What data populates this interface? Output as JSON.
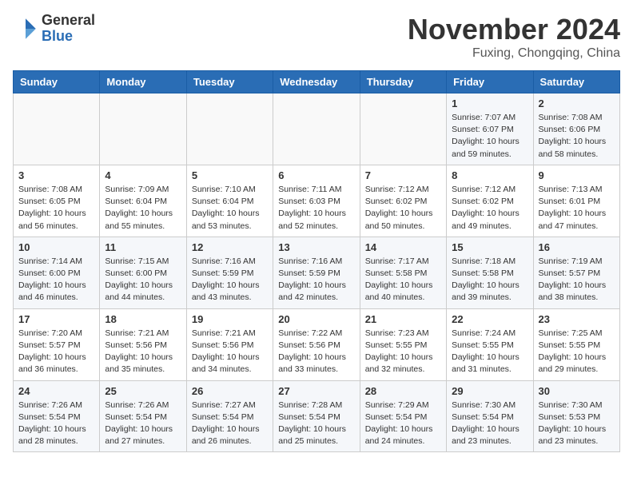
{
  "header": {
    "logo_general": "General",
    "logo_blue": "Blue",
    "title": "November 2024",
    "subtitle": "Fuxing, Chongqing, China"
  },
  "weekdays": [
    "Sunday",
    "Monday",
    "Tuesday",
    "Wednesday",
    "Thursday",
    "Friday",
    "Saturday"
  ],
  "weeks": [
    [
      {
        "day": "",
        "info": ""
      },
      {
        "day": "",
        "info": ""
      },
      {
        "day": "",
        "info": ""
      },
      {
        "day": "",
        "info": ""
      },
      {
        "day": "",
        "info": ""
      },
      {
        "day": "1",
        "info": "Sunrise: 7:07 AM\nSunset: 6:07 PM\nDaylight: 10 hours\nand 59 minutes."
      },
      {
        "day": "2",
        "info": "Sunrise: 7:08 AM\nSunset: 6:06 PM\nDaylight: 10 hours\nand 58 minutes."
      }
    ],
    [
      {
        "day": "3",
        "info": "Sunrise: 7:08 AM\nSunset: 6:05 PM\nDaylight: 10 hours\nand 56 minutes."
      },
      {
        "day": "4",
        "info": "Sunrise: 7:09 AM\nSunset: 6:04 PM\nDaylight: 10 hours\nand 55 minutes."
      },
      {
        "day": "5",
        "info": "Sunrise: 7:10 AM\nSunset: 6:04 PM\nDaylight: 10 hours\nand 53 minutes."
      },
      {
        "day": "6",
        "info": "Sunrise: 7:11 AM\nSunset: 6:03 PM\nDaylight: 10 hours\nand 52 minutes."
      },
      {
        "day": "7",
        "info": "Sunrise: 7:12 AM\nSunset: 6:02 PM\nDaylight: 10 hours\nand 50 minutes."
      },
      {
        "day": "8",
        "info": "Sunrise: 7:12 AM\nSunset: 6:02 PM\nDaylight: 10 hours\nand 49 minutes."
      },
      {
        "day": "9",
        "info": "Sunrise: 7:13 AM\nSunset: 6:01 PM\nDaylight: 10 hours\nand 47 minutes."
      }
    ],
    [
      {
        "day": "10",
        "info": "Sunrise: 7:14 AM\nSunset: 6:00 PM\nDaylight: 10 hours\nand 46 minutes."
      },
      {
        "day": "11",
        "info": "Sunrise: 7:15 AM\nSunset: 6:00 PM\nDaylight: 10 hours\nand 44 minutes."
      },
      {
        "day": "12",
        "info": "Sunrise: 7:16 AM\nSunset: 5:59 PM\nDaylight: 10 hours\nand 43 minutes."
      },
      {
        "day": "13",
        "info": "Sunrise: 7:16 AM\nSunset: 5:59 PM\nDaylight: 10 hours\nand 42 minutes."
      },
      {
        "day": "14",
        "info": "Sunrise: 7:17 AM\nSunset: 5:58 PM\nDaylight: 10 hours\nand 40 minutes."
      },
      {
        "day": "15",
        "info": "Sunrise: 7:18 AM\nSunset: 5:58 PM\nDaylight: 10 hours\nand 39 minutes."
      },
      {
        "day": "16",
        "info": "Sunrise: 7:19 AM\nSunset: 5:57 PM\nDaylight: 10 hours\nand 38 minutes."
      }
    ],
    [
      {
        "day": "17",
        "info": "Sunrise: 7:20 AM\nSunset: 5:57 PM\nDaylight: 10 hours\nand 36 minutes."
      },
      {
        "day": "18",
        "info": "Sunrise: 7:21 AM\nSunset: 5:56 PM\nDaylight: 10 hours\nand 35 minutes."
      },
      {
        "day": "19",
        "info": "Sunrise: 7:21 AM\nSunset: 5:56 PM\nDaylight: 10 hours\nand 34 minutes."
      },
      {
        "day": "20",
        "info": "Sunrise: 7:22 AM\nSunset: 5:56 PM\nDaylight: 10 hours\nand 33 minutes."
      },
      {
        "day": "21",
        "info": "Sunrise: 7:23 AM\nSunset: 5:55 PM\nDaylight: 10 hours\nand 32 minutes."
      },
      {
        "day": "22",
        "info": "Sunrise: 7:24 AM\nSunset: 5:55 PM\nDaylight: 10 hours\nand 31 minutes."
      },
      {
        "day": "23",
        "info": "Sunrise: 7:25 AM\nSunset: 5:55 PM\nDaylight: 10 hours\nand 29 minutes."
      }
    ],
    [
      {
        "day": "24",
        "info": "Sunrise: 7:26 AM\nSunset: 5:54 PM\nDaylight: 10 hours\nand 28 minutes."
      },
      {
        "day": "25",
        "info": "Sunrise: 7:26 AM\nSunset: 5:54 PM\nDaylight: 10 hours\nand 27 minutes."
      },
      {
        "day": "26",
        "info": "Sunrise: 7:27 AM\nSunset: 5:54 PM\nDaylight: 10 hours\nand 26 minutes."
      },
      {
        "day": "27",
        "info": "Sunrise: 7:28 AM\nSunset: 5:54 PM\nDaylight: 10 hours\nand 25 minutes."
      },
      {
        "day": "28",
        "info": "Sunrise: 7:29 AM\nSunset: 5:54 PM\nDaylight: 10 hours\nand 24 minutes."
      },
      {
        "day": "29",
        "info": "Sunrise: 7:30 AM\nSunset: 5:54 PM\nDaylight: 10 hours\nand 23 minutes."
      },
      {
        "day": "30",
        "info": "Sunrise: 7:30 AM\nSunset: 5:53 PM\nDaylight: 10 hours\nand 23 minutes."
      }
    ]
  ]
}
